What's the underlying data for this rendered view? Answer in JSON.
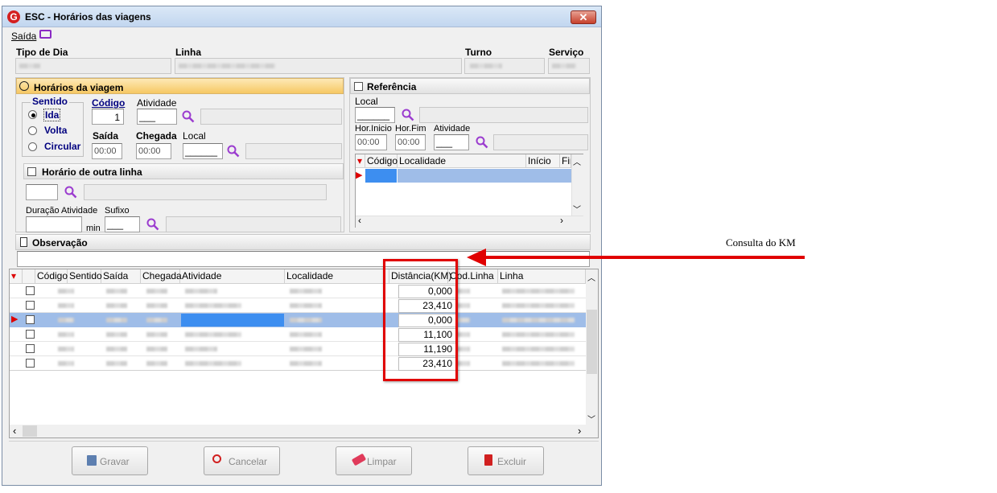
{
  "window": {
    "title": "ESC - Horários das viagens",
    "close_glyph": "✕",
    "logo_letter": "G"
  },
  "menu": {
    "saida": "Saída"
  },
  "top_fields": {
    "tipo_dia": "Tipo de Dia",
    "linha": "Linha",
    "turno": "Turno",
    "servico": "Serviço"
  },
  "horarios": {
    "header": "Horários da viagem",
    "sentido": "Sentido",
    "ida": "Ida",
    "volta": "Volta",
    "circular": "Circular",
    "codigo": "Código",
    "codigo_value": "1",
    "atividade": "Atividade",
    "atividade_value": "___",
    "saida": "Saída",
    "chegada": "Chegada",
    "local": "Local",
    "saida_value": "00:00",
    "chegada_value": "00:00",
    "local_value": "______",
    "outra_linha": "Horário de outra linha",
    "duracao": "Duração Atividade",
    "sufixo": "Sufixo",
    "sufixo_value": "___",
    "min": "min"
  },
  "referencia": {
    "header": "Referência",
    "local": "Local",
    "local_value": "______",
    "hor_inicio": "Hor.Inicio",
    "hor_fim": "Hor.Fim",
    "atividade": "Atividade",
    "hor_inicio_value": "00:00",
    "hor_fim_value": "00:00",
    "atividade_value": "___",
    "columns": [
      "Código",
      "Localidade",
      "Início",
      "Fim"
    ]
  },
  "observacao": {
    "header": "Observação"
  },
  "grid": {
    "columns": [
      "Código",
      "Sentido",
      "Saída",
      "Chegada",
      "Atividade",
      "Localidade",
      "Distância(KM)",
      "Cod.Linha",
      "Linha"
    ],
    "distances": [
      "0,000",
      "23,410",
      "0,000",
      "11,100",
      "11,190",
      "23,410"
    ],
    "selected_row": 2
  },
  "buttons": {
    "gravar": "Gravar",
    "cancelar": "Cancelar",
    "limpar": "Limpar",
    "excluir": "Excluir"
  },
  "annotation": {
    "text": "Consulta do KM",
    "color": "#e00000"
  },
  "colors": {
    "selection": "#9fbde8",
    "header_orange": "#f6c863",
    "highlight_red": "#e00000"
  }
}
